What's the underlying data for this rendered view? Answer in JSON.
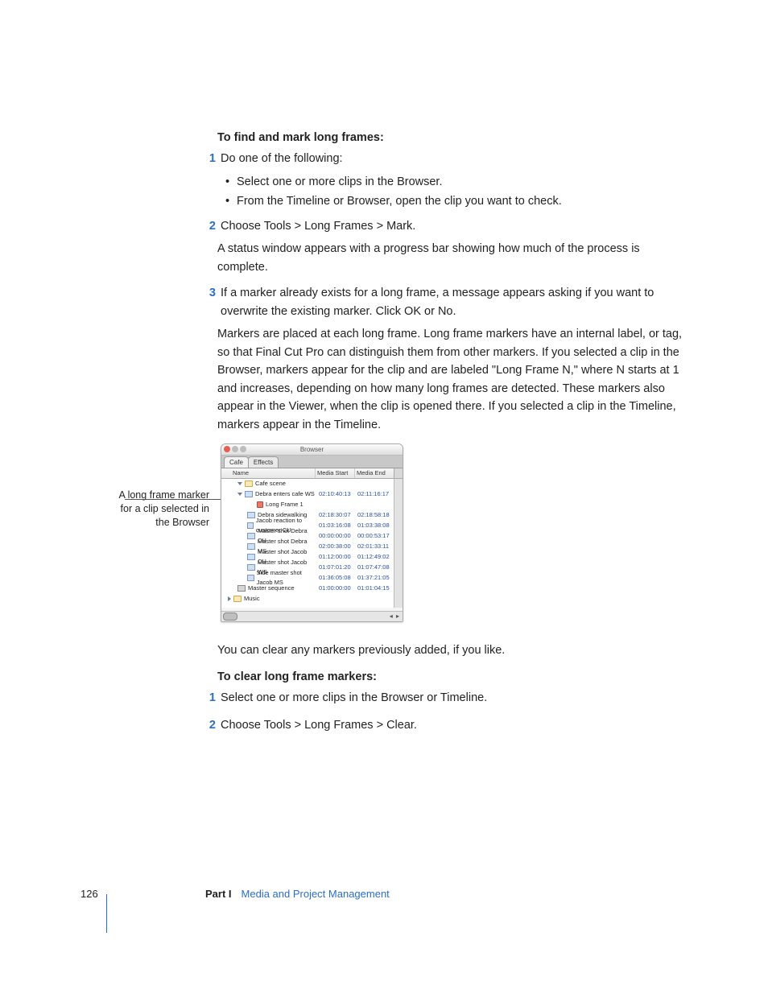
{
  "section1": {
    "heading": "To find and mark long frames:",
    "steps": [
      {
        "num": "1",
        "text": "Do one of the following:"
      },
      {
        "num": "2",
        "text": "Choose Tools > Long Frames > Mark."
      },
      {
        "num": "3",
        "text": "If a marker already exists for a long frame, a message appears asking if you want to overwrite the existing marker. Click OK or No."
      }
    ],
    "bullets": [
      "Select one or more clips in the Browser.",
      "From the Timeline or Browser, open the clip you want to check."
    ],
    "after_step2": "A status window appears with a progress bar showing how much of the process is complete.",
    "after_step3": "Markers are placed at each long frame. Long frame markers have an internal label, or tag, so that Final Cut Pro can distinguish them from other markers. If you selected a clip in the Browser, markers appear for the clip and are labeled \"Long Frame N,\" where N starts at 1 and increases, depending on how many long frames are detected. These markers also appear in the Viewer, when the clip is opened there. If you selected a clip in the Timeline, markers appear in the Timeline."
  },
  "figure": {
    "callout": "A long frame marker for a clip selected in the Browser",
    "window_title": "Browser",
    "tabs": [
      "Cafe",
      "Effects"
    ],
    "columns": {
      "name": "Name",
      "media_start": "Media Start",
      "media_end": "Media End"
    },
    "rows": [
      {
        "indent": 1,
        "tri": "down",
        "icon": "folder",
        "name": "Cafe scene",
        "ms": "",
        "me": ""
      },
      {
        "indent": 1,
        "tri": "down",
        "icon": "clip",
        "name": "Debra enters cafe WS",
        "ms": "02:10:40:13",
        "me": "02:11:16:17"
      },
      {
        "indent": 3,
        "tri": "",
        "icon": "marker",
        "name": "Long Frame 1",
        "ms": "",
        "me": ""
      },
      {
        "indent": 2,
        "tri": "",
        "icon": "clip",
        "name": "Debra sidewalking",
        "ms": "02:18:30:07",
        "me": "02:18:58:18"
      },
      {
        "indent": 2,
        "tri": "",
        "icon": "clip",
        "name": "Jacob reaction to customer CU",
        "ms": "01:03:16:08",
        "me": "01:03:38:08"
      },
      {
        "indent": 2,
        "tri": "",
        "icon": "clip",
        "name": "Master shot Debra CU",
        "ms": "00:00:00:00",
        "me": "00:00:53:17"
      },
      {
        "indent": 2,
        "tri": "",
        "icon": "clip",
        "name": "Master shot Debra MS",
        "ms": "02:00:38:00",
        "me": "02:01:33:11"
      },
      {
        "indent": 2,
        "tri": "",
        "icon": "clip",
        "name": "Master shot Jacob CU",
        "ms": "01:12:00:00",
        "me": "01:12:49:02"
      },
      {
        "indent": 2,
        "tri": "",
        "icon": "clip",
        "name": "Master shot Jacob WS",
        "ms": "01:07:01:20",
        "me": "01:07:47:08"
      },
      {
        "indent": 2,
        "tri": "",
        "icon": "clip",
        "name": "Side master shot Jacob MS",
        "ms": "01:36:05:08",
        "me": "01:37:21:05"
      },
      {
        "indent": 1,
        "tri": "",
        "icon": "seq",
        "name": "Master sequence",
        "ms": "01:00:00:00",
        "me": "01:01:04:15"
      },
      {
        "indent": 0,
        "tri": "right",
        "icon": "folder",
        "name": "Music",
        "ms": "",
        "me": ""
      }
    ]
  },
  "after_figure": "You can clear any markers previously added, if you like.",
  "section2": {
    "heading": "To clear long frame markers:",
    "steps": [
      {
        "num": "1",
        "text": "Select one or more clips in the Browser or Timeline."
      },
      {
        "num": "2",
        "text": "Choose Tools > Long Frames > Clear."
      }
    ]
  },
  "footer": {
    "page": "126",
    "part": "Part I",
    "title": "Media and Project Management"
  }
}
